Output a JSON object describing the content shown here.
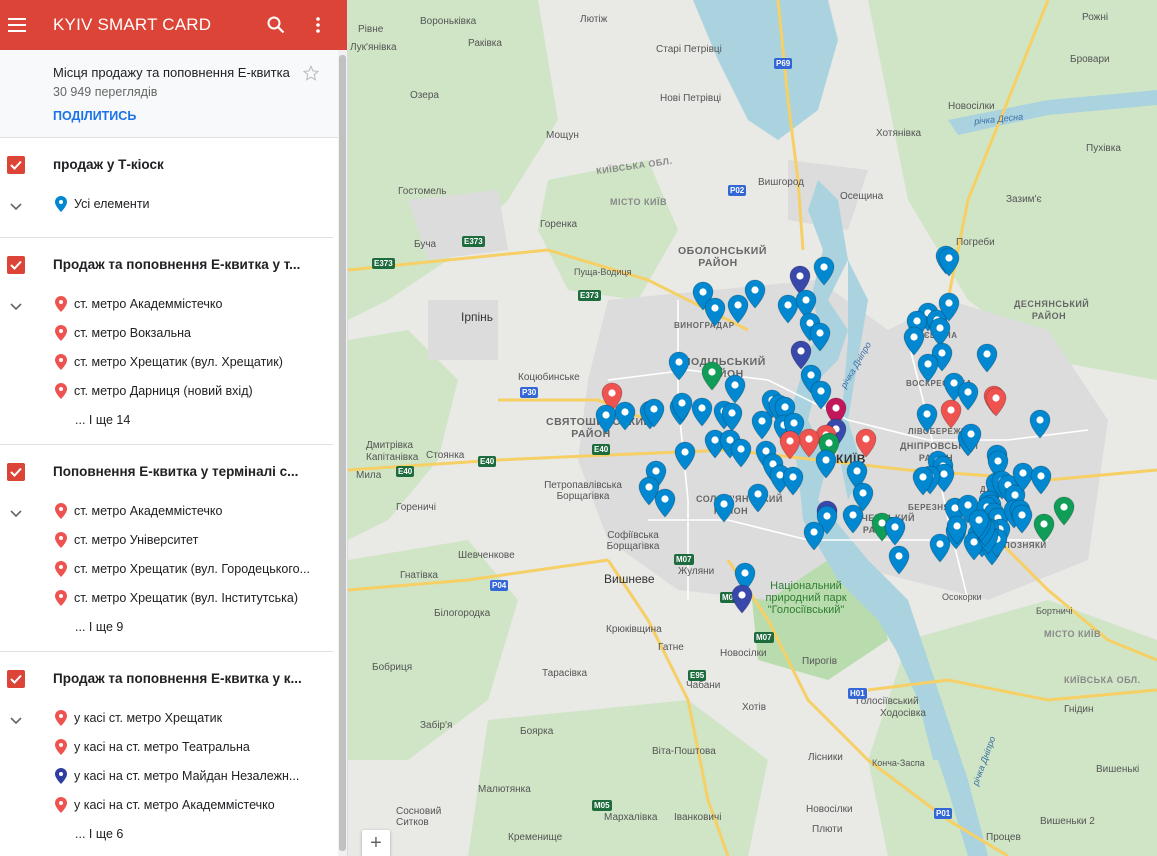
{
  "header": {
    "title": "KYIV SMART CARD"
  },
  "mapinfo": {
    "title": "Місця продажу та поповнення Е-квитка",
    "views": "30 949 переглядів",
    "share": "ПОДІЛИТИСЬ"
  },
  "layers": [
    {
      "title": "продаж у Т-кіоск",
      "items": [
        {
          "label": "Усі елементи",
          "pin_color": "#0288d1"
        }
      ],
      "more": ""
    },
    {
      "title": "Продаж та поповнення Е-квитка у т...",
      "items": [
        {
          "label": "ст. метро Академмістечко",
          "pin_color": "#ef5350"
        },
        {
          "label": "ст. метро Вокзальна",
          "pin_color": "#ef5350"
        },
        {
          "label": "ст. метро Хрещатик (вул. Хрещатик)",
          "pin_color": "#ef5350"
        },
        {
          "label": "ст. метро Дарниця (новий вхід)",
          "pin_color": "#ef5350"
        }
      ],
      "more": "І ще 14"
    },
    {
      "title": "Поповнення Е-квитка у терміналі с...",
      "items": [
        {
          "label": "ст. метро Академмістечко",
          "pin_color": "#ef5350"
        },
        {
          "label": "ст. метро Університет",
          "pin_color": "#ef5350"
        },
        {
          "label": "ст. метро Хрещатик (вул. Городецького...",
          "pin_color": "#ef5350"
        },
        {
          "label": "ст. метро Хрещатик (вул. Інститутська)",
          "pin_color": "#ef5350"
        }
      ],
      "more": "І ще 9"
    },
    {
      "title": "Продаж та поповнення Е-квитка у к...",
      "items": [
        {
          "label": "у касі ст. метро Хрещатик",
          "pin_color": "#ef5350"
        },
        {
          "label": "у касі на ст. метро Театральна",
          "pin_color": "#ef5350"
        },
        {
          "label": "у касі на ст. метро Майдан Незалежн...",
          "pin_color": "#303f9f"
        },
        {
          "label": "у касі на ст. метро Академмістечко",
          "pin_color": "#ef5350"
        }
      ],
      "more": "І ще 6"
    }
  ],
  "map": {
    "places": [
      "Вороньківка",
      "Лютіж",
      "Рівне",
      "Лук'янівка",
      "Раківка",
      "Старі Петрівці",
      "Бровари",
      "Рожні",
      "Озера",
      "Нові Петрівці",
      "Новосілки",
      "Мощун",
      "Хотянівка",
      "Пухівка",
      "Вишгород",
      "Осещина",
      "Гостомель",
      "Зазим'є",
      "Горенка",
      "Буча",
      "Погреби",
      "Пуща-Водиця",
      "Ірпінь",
      "Ірпінь",
      "Коцюбинське",
      "Дмитрівка",
      "Капітанівка",
      "Стоянка",
      "Мила",
      "Петропавлівська Борщагівка",
      "Гореничі",
      "Софіївська Борщагівка",
      "Шевченкове",
      "Гнатівка",
      "Вишневе",
      "Жуляни",
      "Білогородка",
      "Крюківщина",
      "Гатне",
      "Новосілки",
      "Бобриця",
      "Тарасівка",
      "Чабани",
      "Пирогів",
      "Голосіївський",
      "Ходосівка",
      "Хотів",
      "Гнідин",
      "Осокорки",
      "Бортничі",
      "Забір'я",
      "Боярка",
      "Віта-Поштова",
      "Лісники",
      "Конча-Заспа",
      "Вишенькі",
      "Малютянка",
      "Мархалівка",
      "Іванковичі",
      "Новосілки",
      "Вишеньки 2",
      "Процев",
      "Кременище",
      "Сосновий Ситков",
      "Плюти",
      "Вишгород"
    ],
    "districts": [
      "ОБОЛОНСЬКИЙ РАЙОН",
      "ПОДІЛЬСЬКИЙ РАЙОН",
      "СВЯТОШИНСЬКИЙ РАЙОН",
      "ДЕСНЯНСЬКИЙ РАЙОН",
      "ДНІПРОВСЬКИЙ РАЙОН",
      "СОЛОМ'ЯНСЬКИЙ РАЙОН",
      "ПЕЧЕРСЬКИЙ РАЙОН",
      "ВИНОГРАДАР",
      "ТРОЄЩИНА",
      "ВОСКРЕСЕНКА",
      "ЛІВОБЕРЕЖНА",
      "БЕРЕЗНЯКИ",
      "ДАРНИЦЯ",
      "ПОЗНЯКИ",
      "КИЇВ"
    ],
    "regions": [
      "КИЇВСЬКА ОБЛ.",
      "МІСТО КИЇВ",
      "КИЇВСЬКА ОБЛ.",
      "МІСТО КИЇВ"
    ],
    "green_area": "Національний природний парк \"Голосіївський\"",
    "rivers": [
      "річка Десна",
      "річка Дніпро",
      "річка Дніпро"
    ],
    "roads": [
      "P69",
      "P02",
      "E373",
      "E373",
      "E373",
      "P30",
      "E40",
      "E40",
      "E40",
      "M07",
      "M07",
      "P04",
      "E95",
      "H01",
      "M05",
      "P01",
      "M07"
    ],
    "zoom_in_label": "+"
  }
}
